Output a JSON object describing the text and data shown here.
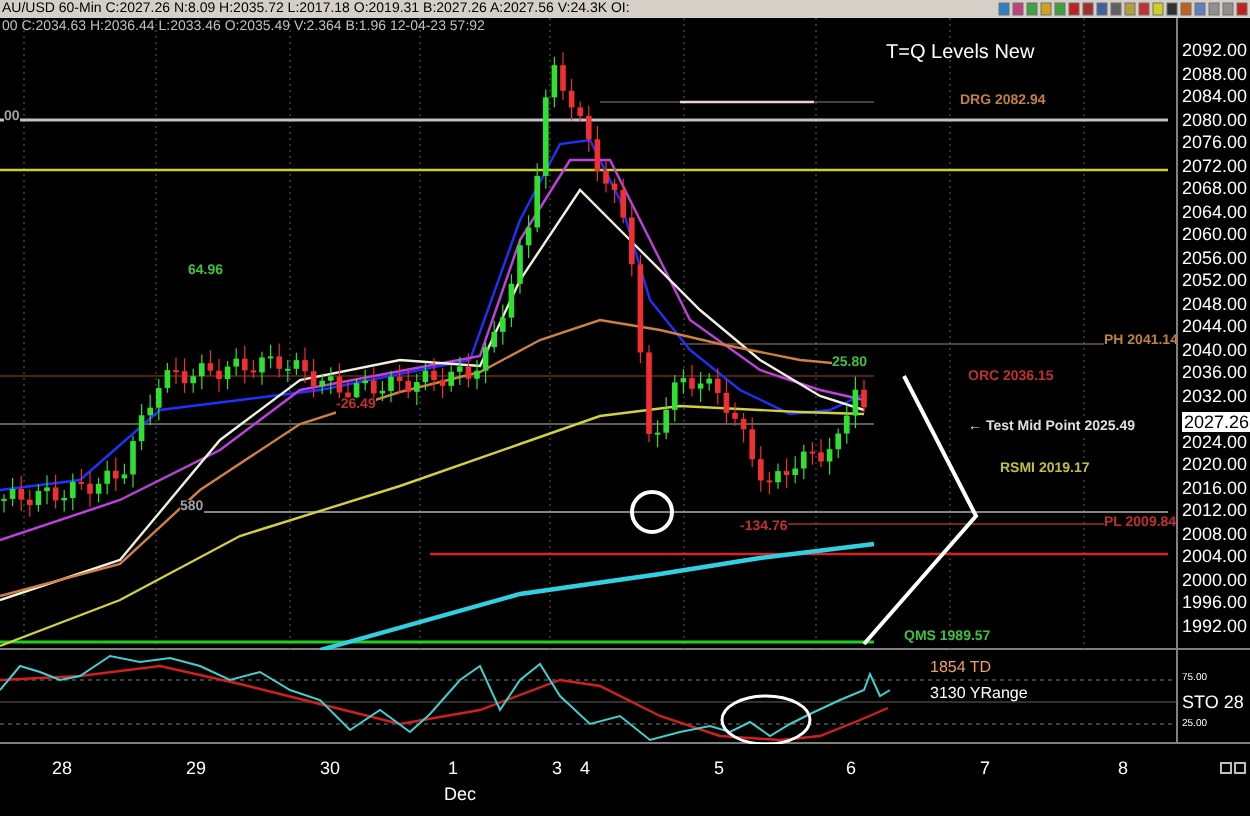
{
  "header": {
    "title": "AU/USD 60-Min C:2027.26 N:8.09 H:2035.72 L:2017.18 O:2019.31 B:2027.26 A:2027.56 V:24.3K OI:"
  },
  "info_line": "00 C:2034.63 H:2036.44 L:2033.46 O:2035.49 V:2.364 B:1.96 12-04-23 57:92",
  "chart": {
    "title": "T=Q Levels New",
    "price_labels": [
      "2092.00",
      "2088.00",
      "2084.00",
      "2080.00",
      "2076.00",
      "2072.00",
      "2068.00",
      "2064.00",
      "2060.00",
      "2056.00",
      "2052.00",
      "2048.00",
      "2044.00",
      "2040.00",
      "2036.00",
      "2032.00",
      "2024.00",
      "2020.00",
      "2016.00",
      "2012.00",
      "2008.00",
      "2004.00",
      "2000.00",
      "1996.00",
      "1992.00"
    ],
    "current_price": "2027.26",
    "annotations": [
      {
        "text": "DRG 2082.94",
        "color": "#c08040"
      },
      {
        "text": "PH 2041.14",
        "color": "#c08040"
      },
      {
        "text": "25.80",
        "color": "#40c040"
      },
      {
        "text": "ORC 2036.15",
        "color": "#c03030"
      },
      {
        "text": "← Test Mid Point 2025.49",
        "color": "#e0e0e0"
      },
      {
        "text": "RSMI 2019.17",
        "color": "#c0c040"
      },
      {
        "text": "PL 2009.84",
        "color": "#c03030"
      },
      {
        "text": "-134.76",
        "color": "#c03030"
      },
      {
        "text": "-26.49",
        "color": "#c03030"
      },
      {
        "text": "64.96",
        "color": "#40c040"
      },
      {
        "text": "580",
        "color": "#a0a0a0"
      },
      {
        "text": "QMS 1989.57",
        "color": "#40c040"
      },
      {
        "text": "00",
        "color": "#a0a0a0"
      }
    ]
  },
  "indicator": {
    "readings": [
      {
        "text": "1854 TD",
        "color": "#f0a060"
      },
      {
        "text": "3130 YRange",
        "color": "#ffffff"
      }
    ],
    "label": "STO 28",
    "axis": [
      "75.00",
      "25.00"
    ]
  },
  "x_axis": {
    "labels": [
      "28",
      "29",
      "30",
      "1",
      "3",
      "4",
      "5",
      "6",
      "7",
      "8"
    ],
    "month": "Dec"
  }
}
